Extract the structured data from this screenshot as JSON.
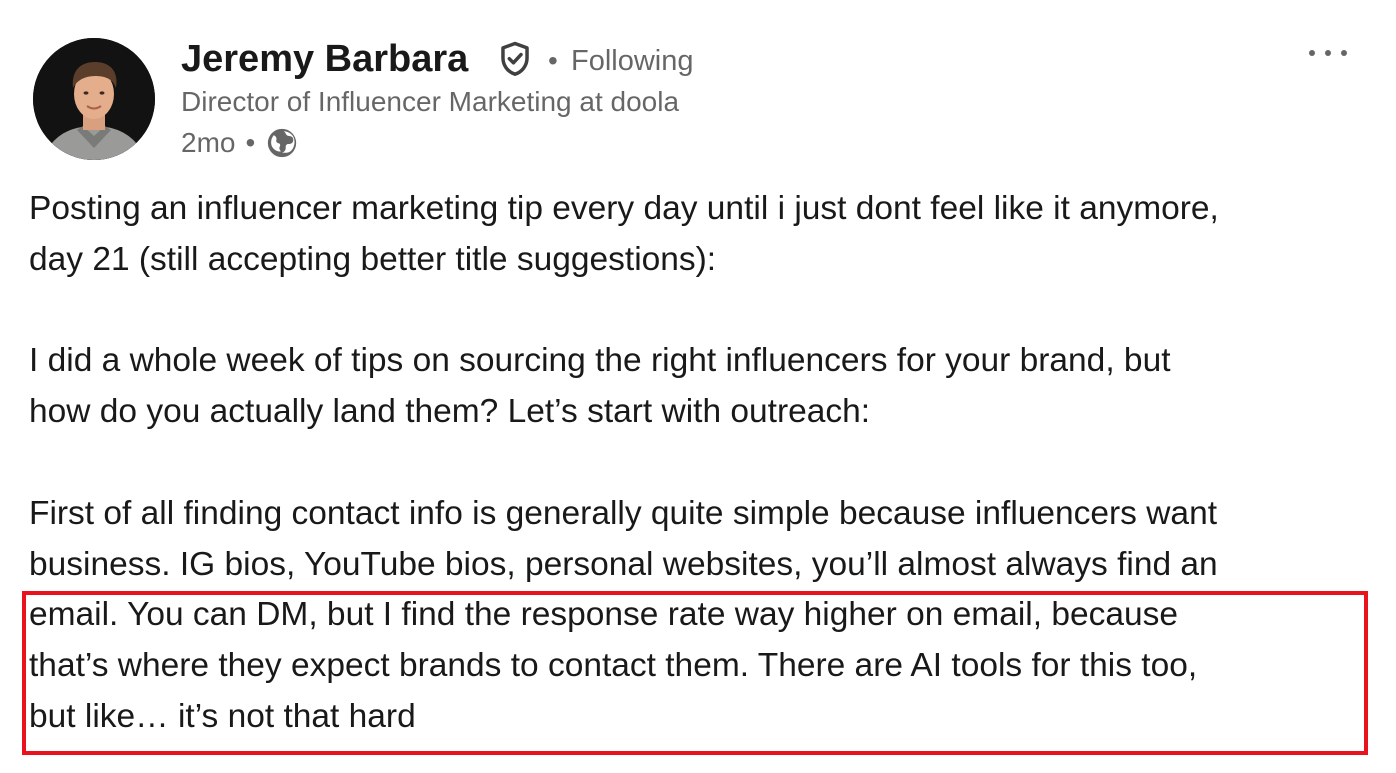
{
  "author": {
    "name": "Jeremy Barbara",
    "verified_icon": "verified-shield-check-icon",
    "follow_separator": "•",
    "follow_status": "Following",
    "headline": "Director of Influencer Marketing at doola",
    "time_ago": "2mo",
    "meta_separator": "•",
    "visibility_icon": "globe-icon"
  },
  "actions": {
    "more_icon": "more-options-icon"
  },
  "post": {
    "paragraphs": [
      {
        "lines": [
          "Posting an influencer marketing tip every day until i just dont feel like it anymore,",
          "day 21 (still accepting better title suggestions):"
        ]
      },
      {
        "lines": [
          "I did a whole week of tips on sourcing the right influencers for your brand, but",
          "how do you actually land them? Let’s start with outreach:"
        ]
      },
      {
        "lines": [
          "First of all finding contact info is generally quite simple because influencers want",
          "business. IG bios, YouTube bios, personal websites, you’ll almost always find an",
          "email. You can DM, but I find the response rate way higher on email, because",
          "that’s where they expect brands to contact them. There are AI tools for this too,",
          "but like… it’s not that hard"
        ]
      }
    ]
  },
  "colors": {
    "highlight_border": "#e8131c",
    "primary_text": "rgba(0,0,0,0.9)",
    "secondary_text": "rgba(0,0,0,0.6)"
  }
}
